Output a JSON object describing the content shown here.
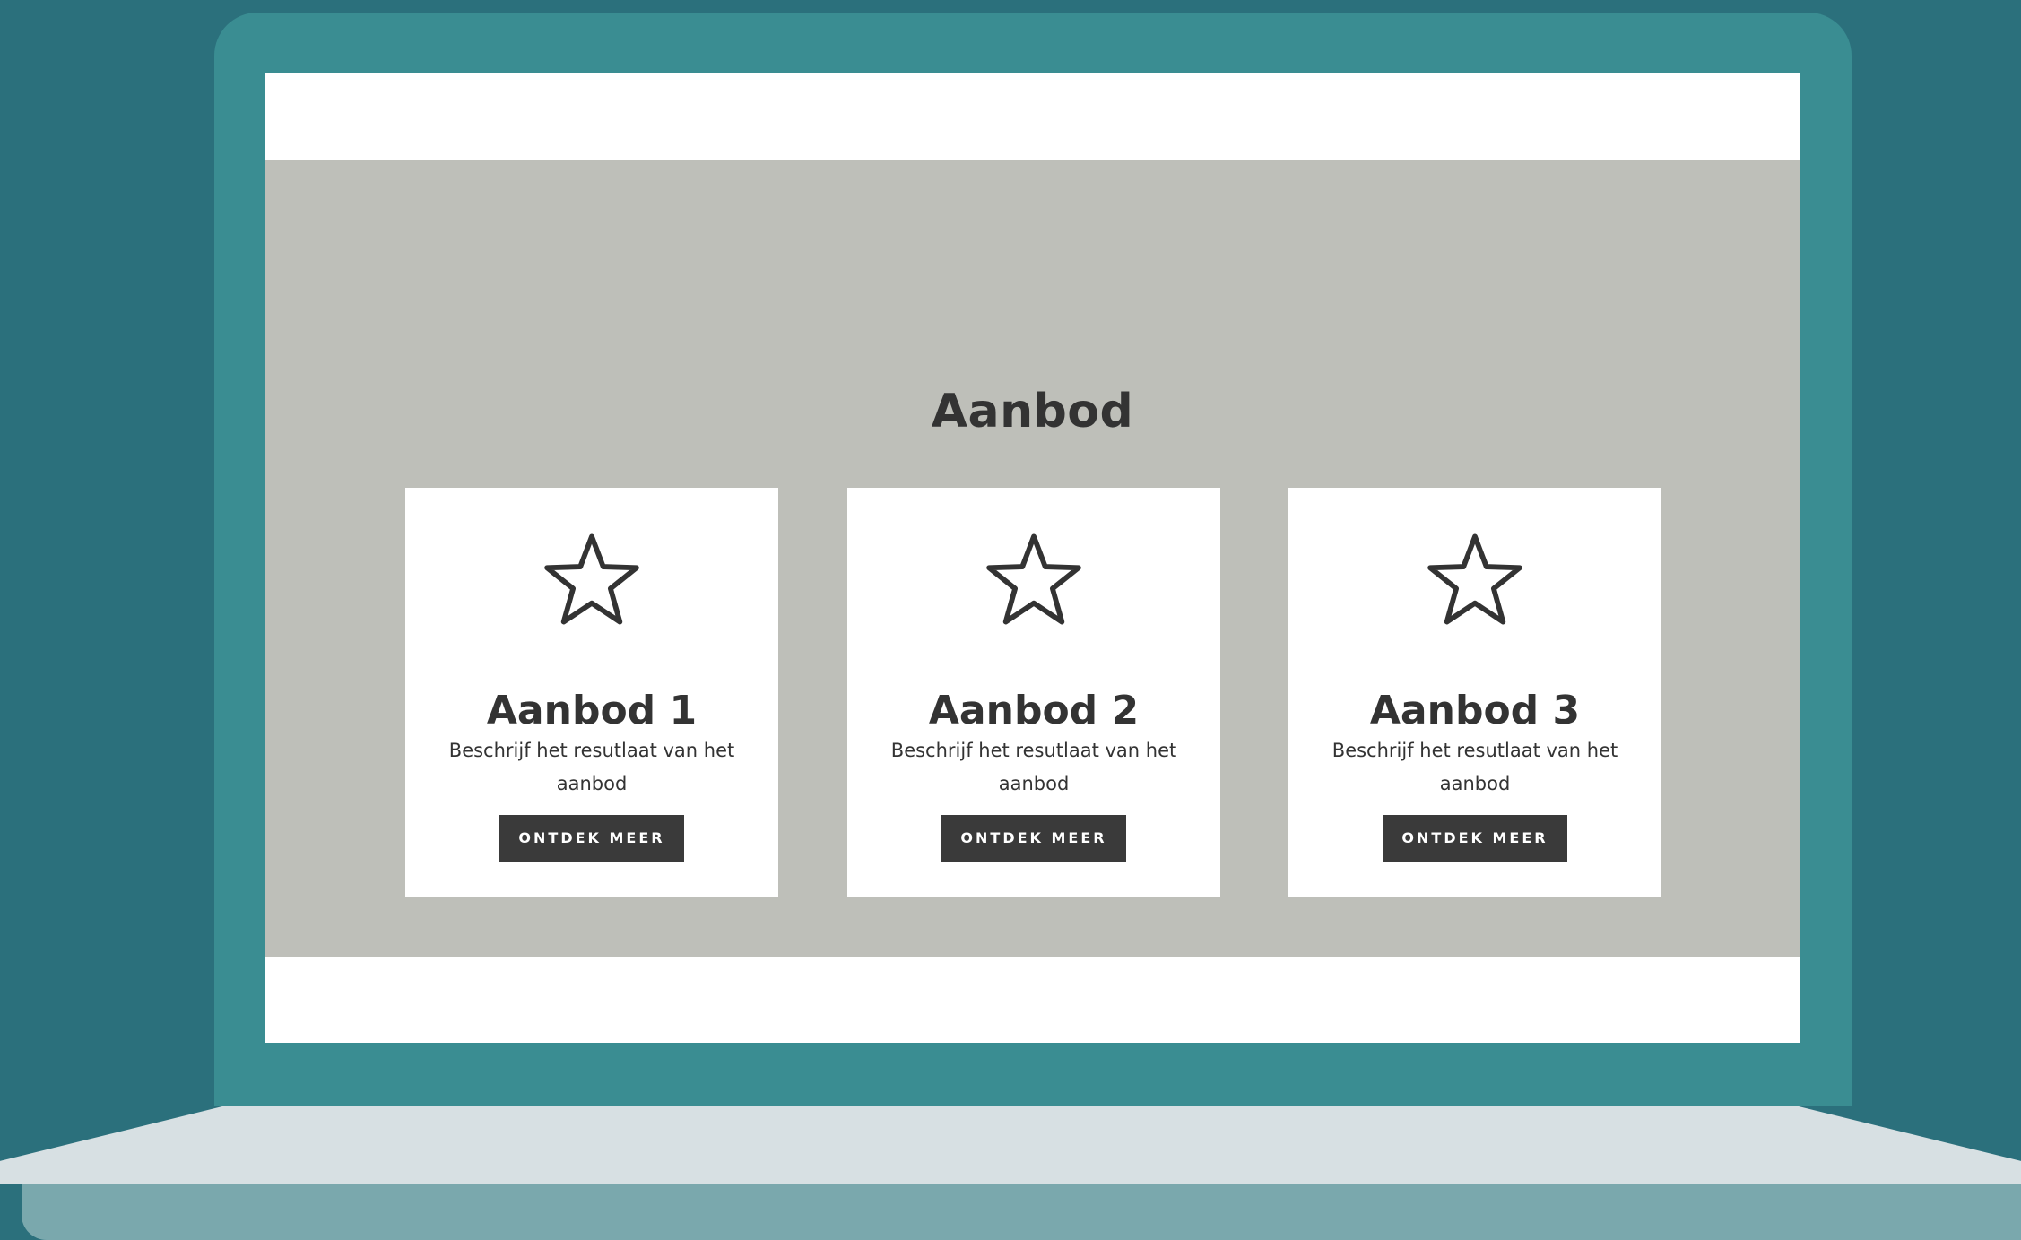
{
  "colors": {
    "background": "#2b707c",
    "laptop_frame": "#3a8d92",
    "laptop_base": "#d7e0e3",
    "laptop_base_edge": "#7aa8ad",
    "section_background": "#bebfb9",
    "card_background": "#ffffff",
    "text": "#333333",
    "button": "#3a3a3a",
    "button_text": "#ffffff"
  },
  "section": {
    "title": "Aanbod"
  },
  "cards": [
    {
      "icon": "star-outline-icon",
      "title": "Aanbod 1",
      "text": "Beschrijf het resutlaat van het aanbod",
      "button_label": "ONTDEK MEER"
    },
    {
      "icon": "star-outline-icon",
      "title": "Aanbod 2",
      "text": "Beschrijf het resutlaat van het aanbod",
      "button_label": "ONTDEK MEER"
    },
    {
      "icon": "star-outline-icon",
      "title": "Aanbod 3",
      "text": "Beschrijf het resutlaat van het aanbod",
      "button_label": "ONTDEK MEER"
    }
  ]
}
